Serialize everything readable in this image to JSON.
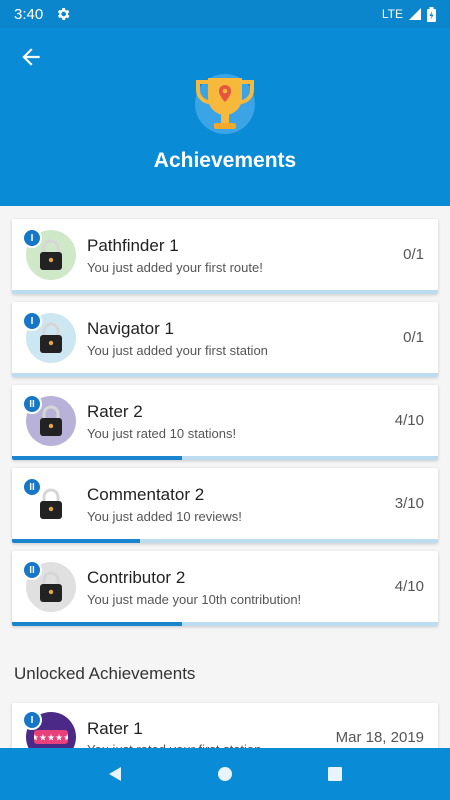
{
  "status": {
    "time": "3:40",
    "network": "LTE"
  },
  "header": {
    "title": "Achievements"
  },
  "achievements": [
    {
      "level": "I",
      "name": "Pathfinder 1",
      "description": "You just added your first route!",
      "progress": "0/1",
      "fraction": 0
    },
    {
      "level": "I",
      "name": "Navigator 1",
      "description": "You just added your first station",
      "progress": "0/1",
      "fraction": 0
    },
    {
      "level": "II",
      "name": "Rater 2",
      "description": "You just rated 10 stations!",
      "progress": "4/10",
      "fraction": 0.4
    },
    {
      "level": "II",
      "name": "Commentator 2",
      "description": "You just added 10 reviews!",
      "progress": "3/10",
      "fraction": 0.3
    },
    {
      "level": "II",
      "name": "Contributor 2",
      "description": "You just made your 10th contribution!",
      "progress": "4/10",
      "fraction": 0.4
    }
  ],
  "unlocked_section": {
    "title": "Unlocked Achievements",
    "items": [
      {
        "level": "I",
        "name": "Rater 1",
        "description": "You just rated your first station",
        "date": "Mar 18, 2019"
      }
    ]
  },
  "colors": {
    "primary": "#0a8bd6",
    "accent": "#1a84cf",
    "progress_track": "#bcdcef"
  }
}
